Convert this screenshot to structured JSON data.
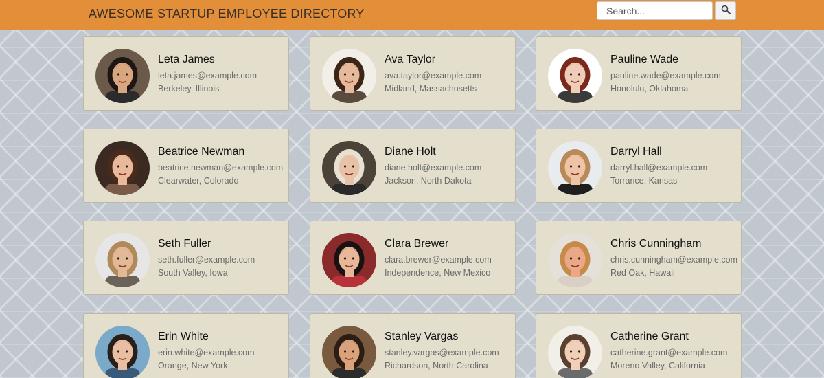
{
  "header": {
    "title": "AWESOME STARTUP EMPLOYEE DIRECTORY",
    "search_placeholder": "Search...",
    "search_icon": "magnifier-icon"
  },
  "employees": [
    {
      "name": "Leta James",
      "email": "leta.james@example.com",
      "location": "Berkeley, Illinois",
      "skin": "#d9a77f",
      "hair": "#1e1612",
      "bg": "#6b5a4a",
      "shirt": "#2b2b2b"
    },
    {
      "name": "Ava Taylor",
      "email": "ava.taylor@example.com",
      "location": "Midland, Massachusetts",
      "skin": "#e6b99a",
      "hair": "#3b2618",
      "bg": "#f2efe9",
      "shirt": "#5b4a3e"
    },
    {
      "name": "Pauline Wade",
      "email": "pauline.wade@example.com",
      "location": "Honolulu, Oklahoma",
      "skin": "#f0cdb8",
      "hair": "#7a2a1a",
      "bg": "#ffffff",
      "shirt": "#3a3a3a"
    },
    {
      "name": "Beatrice Newman",
      "email": "beatrice.newman@example.com",
      "location": "Clearwater, Colorado",
      "skin": "#e9b99b",
      "hair": "#4a2a1a",
      "bg": "#3a2a22",
      "shirt": "#7a5a48"
    },
    {
      "name": "Diane Holt",
      "email": "diane.holt@example.com",
      "location": "Jackson, North Dakota",
      "skin": "#e7c2a6",
      "hair": "#e8e0d2",
      "bg": "#4b4238",
      "shirt": "#2a2a2a"
    },
    {
      "name": "Darryl Hall",
      "email": "darryl.hall@example.com",
      "location": "Torrance, Kansas",
      "skin": "#efc3a5",
      "hair": "#b88a5a",
      "bg": "#e9ecef",
      "shirt": "#1e1e1e"
    },
    {
      "name": "Seth Fuller",
      "email": "seth.fuller@example.com",
      "location": "South Valley, Iowa",
      "skin": "#e3b896",
      "hair": "#b08a5a",
      "bg": "#e6e6e6",
      "shirt": "#6b6357"
    },
    {
      "name": "Clara Brewer",
      "email": "clara.brewer@example.com",
      "location": "Independence, New Mexico",
      "skin": "#e8b79a",
      "hair": "#1a1212",
      "bg": "#8a2a2a",
      "shirt": "#b8323a"
    },
    {
      "name": "Chris Cunningham",
      "email": "chris.cunningham@example.com",
      "location": "Red Oak, Hawaii",
      "skin": "#eaa886",
      "hair": "#c68b4a",
      "bg": "#e5e0d8",
      "shirt": "#d8d0c4"
    },
    {
      "name": "Erin White",
      "email": "erin.white@example.com",
      "location": "Orange, New York",
      "skin": "#e8bfa3",
      "hair": "#2a1e1a",
      "bg": "#7aa9c9",
      "shirt": "#3a5a7a"
    },
    {
      "name": "Stanley Vargas",
      "email": "stanley.vargas@example.com",
      "location": "Richardson, North Carolina",
      "skin": "#d9a27c",
      "hair": "#2b1d14",
      "bg": "#7a5a3e",
      "shirt": "#2b2b2b"
    },
    {
      "name": "Catherine Grant",
      "email": "catherine.grant@example.com",
      "location": "Moreno Valley, California",
      "skin": "#f0d0b8",
      "hair": "#5a4030",
      "bg": "#f2efe9",
      "shirt": "#6b6b6b"
    }
  ]
}
